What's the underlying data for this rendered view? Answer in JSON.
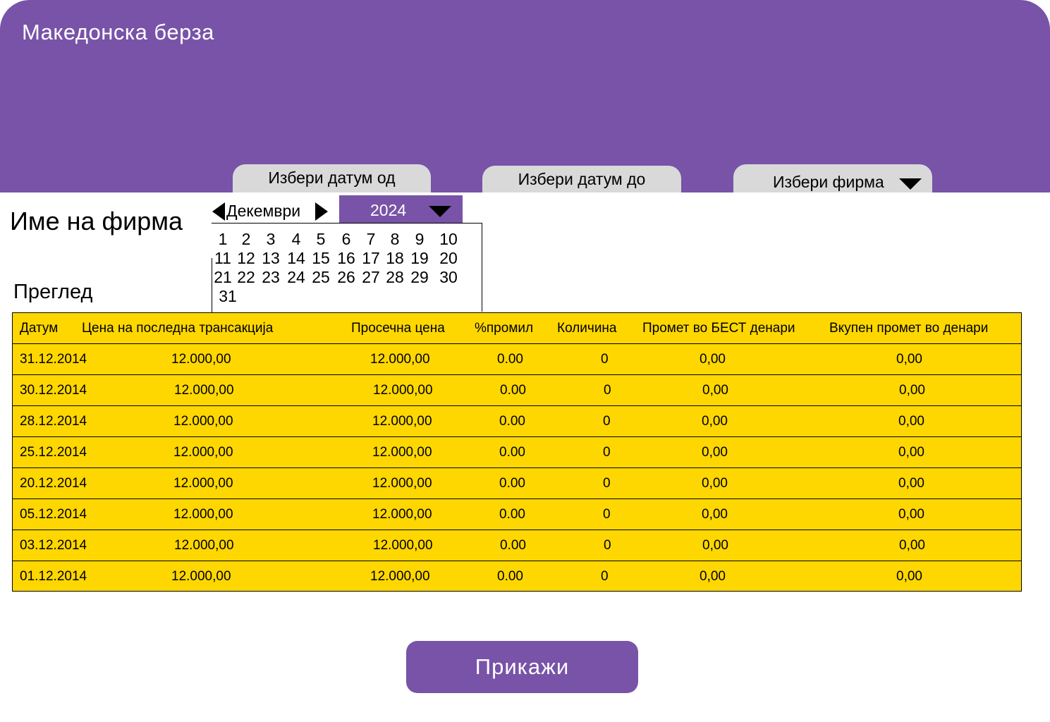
{
  "app": {
    "title": "Македонска берза"
  },
  "tabs": {
    "date_from": "Избери датум од",
    "date_to": "Избери датум до",
    "firm": "Избери фирма"
  },
  "firm_name": "Име на фирма",
  "section_title": "Преглед",
  "calendar": {
    "month": "Декември",
    "year": "2024",
    "days": [
      "1",
      "2",
      "3",
      "4",
      "5",
      "6",
      "7",
      "8",
      "9",
      "10",
      "11",
      "12",
      "13",
      "14",
      "15",
      "16",
      "17",
      "18",
      "19",
      "20",
      "21",
      "22",
      "23",
      "24",
      "25",
      "26",
      "27",
      "28",
      "29",
      "30",
      "31"
    ]
  },
  "table": {
    "headers": [
      "Датум",
      "Цена на последна трансакција",
      "Просечна цена",
      "%промил",
      "Количина",
      "Промет во БЕСТ денари",
      "Вкупен промет во денари"
    ],
    "rows": [
      [
        "31.12.2014",
        "12.000,00",
        "12.000,00",
        "0.00",
        "0",
        "0,00",
        "0,00"
      ],
      [
        "30.12.2014",
        "12.000,00",
        "12.000,00",
        "0.00",
        "0",
        "0,00",
        "0,00"
      ],
      [
        "28.12.2014",
        "12.000,00",
        "12.000,00",
        "0.00",
        "0",
        "0,00",
        "0,00"
      ],
      [
        "25.12.2014",
        "12.000,00",
        "12.000,00",
        "0.00",
        "0",
        "0,00",
        "0,00"
      ],
      [
        "20.12.2014",
        "12.000,00",
        "12.000,00",
        "0.00",
        "0",
        "0,00",
        "0,00"
      ],
      [
        "05.12.2014",
        "12.000,00",
        "12.000,00",
        "0.00",
        "0",
        "0,00",
        "0,00"
      ],
      [
        "03.12.2014",
        "12.000,00",
        "12.000,00",
        "0.00",
        "0",
        "0,00",
        "0,00"
      ],
      [
        "01.12.2014",
        "12.000,00",
        "12.000,00",
        "0.00",
        "0",
        "0,00",
        "0,00"
      ]
    ]
  },
  "actions": {
    "show_label": "Прикажи"
  },
  "colors": {
    "brand": "#7853a8",
    "table_bg": "#ffd700",
    "tab_bg": "#d9d9d9"
  }
}
